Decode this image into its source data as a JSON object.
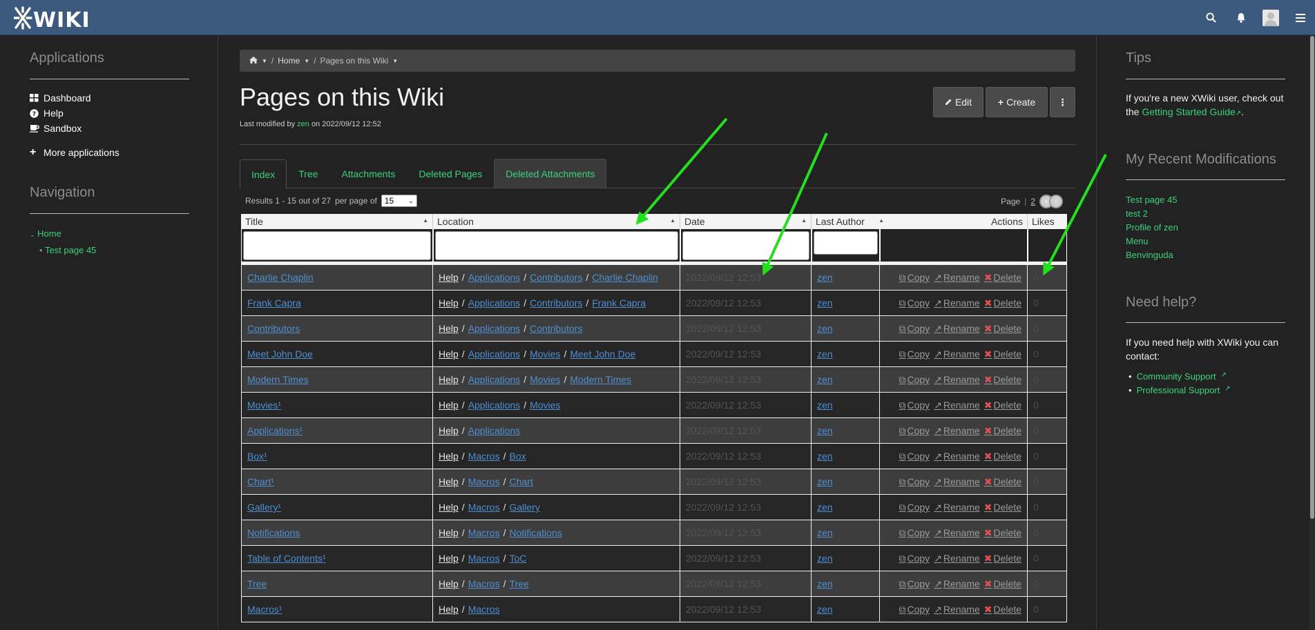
{
  "topbar": {
    "logo": "XWIKI",
    "icons": [
      "search-icon",
      "bell-icon",
      "avatar",
      "menu-icon"
    ]
  },
  "left": {
    "applications_title": "Applications",
    "apps": [
      {
        "label": "Dashboard",
        "icon": "grid-icon"
      },
      {
        "label": "Help",
        "icon": "question-icon"
      },
      {
        "label": "Sandbox",
        "icon": "coffee-icon"
      }
    ],
    "more_apps": "More applications",
    "navigation_title": "Navigation",
    "nav_home": "Home",
    "nav_child": "Test page 45"
  },
  "breadcrumb": {
    "home": "Home",
    "current": "Pages on this Wiki"
  },
  "page": {
    "title": "Pages on this Wiki",
    "modified_prefix": "Last modified by",
    "modified_user": "zen",
    "modified_suffix": "on 2022/09/12 12:52"
  },
  "buttons": {
    "edit": "Edit",
    "create": "Create",
    "more": "⋮"
  },
  "tabs": [
    "Index",
    "Tree",
    "Attachments",
    "Deleted Pages",
    "Deleted Attachments"
  ],
  "results": {
    "text": "Results 1 - 15 out of 27",
    "per_page": "per page of",
    "per_page_value": "15",
    "page_label": "Page",
    "page_num": "2"
  },
  "table": {
    "headers": {
      "title": "Title",
      "location": "Location",
      "date": "Date",
      "author": "Last Author",
      "actions": "Actions",
      "likes": "Likes"
    },
    "action_labels": {
      "copy": "Copy",
      "rename": "Rename",
      "delete": "Delete"
    },
    "rows": [
      {
        "title": "Charlie Chaplin",
        "loc": [
          "Help",
          "Applications",
          "Contributors",
          "Charlie Chaplin"
        ],
        "date": "2022/09/12 12:53",
        "author": "zen",
        "likes": "0"
      },
      {
        "title": "Frank Capra",
        "loc": [
          "Help",
          "Applications",
          "Contributors",
          "Frank Capra"
        ],
        "date": "2022/09/12 12:53",
        "author": "zen",
        "likes": "0"
      },
      {
        "title": "Contributors",
        "loc": [
          "Help",
          "Applications",
          "Contributors"
        ],
        "date": "2022/09/12 12:53",
        "author": "zen",
        "likes": "0"
      },
      {
        "title": "Meet John Doe",
        "loc": [
          "Help",
          "Applications",
          "Movies",
          "Meet John Doe"
        ],
        "date": "2022/09/12 12:53",
        "author": "zen",
        "likes": "0"
      },
      {
        "title": "Modern Times",
        "loc": [
          "Help",
          "Applications",
          "Movies",
          "Modern Times"
        ],
        "date": "2022/09/12 12:53",
        "author": "zen",
        "likes": "0"
      },
      {
        "title": "Movies¹",
        "loc": [
          "Help",
          "Applications",
          "Movies"
        ],
        "date": "2022/09/12 12:53",
        "author": "zen",
        "likes": "0"
      },
      {
        "title": "Applications¹",
        "loc": [
          "Help",
          "Applications"
        ],
        "date": "2022/09/12 12:53",
        "author": "zen",
        "likes": "0"
      },
      {
        "title": "Box¹",
        "loc": [
          "Help",
          "Macros",
          "Box"
        ],
        "date": "2022/09/12 12:53",
        "author": "zen",
        "likes": "0"
      },
      {
        "title": "Chart¹",
        "loc": [
          "Help",
          "Macros",
          "Chart"
        ],
        "date": "2022/09/12 12:53",
        "author": "zen",
        "likes": "0"
      },
      {
        "title": "Gallery¹",
        "loc": [
          "Help",
          "Macros",
          "Gallery"
        ],
        "date": "2022/09/12 12:53",
        "author": "zen",
        "likes": "0"
      },
      {
        "title": "Notifications",
        "loc": [
          "Help",
          "Macros",
          "Notifications"
        ],
        "date": "2022/09/12 12:53",
        "author": "zen",
        "likes": "0"
      },
      {
        "title": "Table of Contents¹",
        "loc": [
          "Help",
          "Macros",
          "ToC"
        ],
        "date": "2022/09/12 12:53",
        "author": "zen",
        "likes": "0"
      },
      {
        "title": "Tree",
        "loc": [
          "Help",
          "Macros",
          "Tree"
        ],
        "date": "2022/09/12 12:53",
        "author": "zen",
        "likes": "0"
      },
      {
        "title": "Macros¹",
        "loc": [
          "Help",
          "Macros"
        ],
        "date": "2022/09/12 12:53",
        "author": "zen",
        "likes": "0"
      }
    ]
  },
  "right": {
    "tips_title": "Tips",
    "tips_text_1": "If you're a new XWiki user, check out the",
    "tips_link": "Getting Started Guide",
    "tips_text_2": ".",
    "recent_title": "My Recent Modifications",
    "recent": [
      "Test page 45",
      "test 2",
      "Profile of zen",
      "Menu",
      "Benvinguda"
    ],
    "help_title": "Need help?",
    "help_text": "If you need help with XWiki you can contact:",
    "help_links": [
      "Community Support",
      "Professional Support"
    ]
  },
  "colors": {
    "accent": "#3ad27d",
    "topbar": "#3c5a7e",
    "link_blue": "#4f8fd1",
    "annotation_arrow": "#22e01e"
  }
}
